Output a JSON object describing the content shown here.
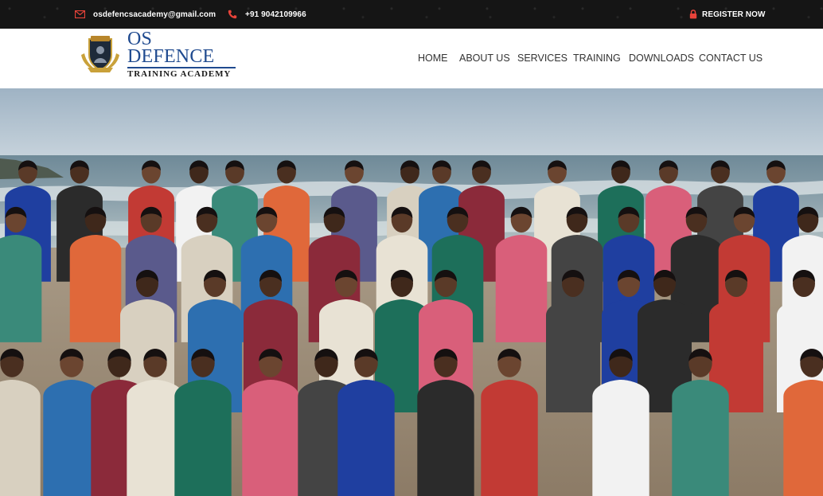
{
  "topbar": {
    "email": "osdefencsacademy@gmail.com",
    "phone": "+91 9042109966",
    "register": "REGISTER NOW",
    "email_icon": "envelope-icon",
    "phone_icon": "phone-icon",
    "register_icon": "lock-icon"
  },
  "logo": {
    "title": "OS DEFENCE",
    "subtitle": "TRAINING ACADEMY"
  },
  "nav": {
    "items": [
      "HOME",
      "ABOUT US",
      "SERVICES",
      "TRAINING",
      "DOWNLOADS",
      "CONTACT US"
    ]
  },
  "hero": {
    "image": "group-photo-on-beach"
  },
  "colors": {
    "topbar_bg": "#151515",
    "accent_red": "#e8433a",
    "logo_blue": "#1f4a8f",
    "nav_text": "#333333"
  }
}
